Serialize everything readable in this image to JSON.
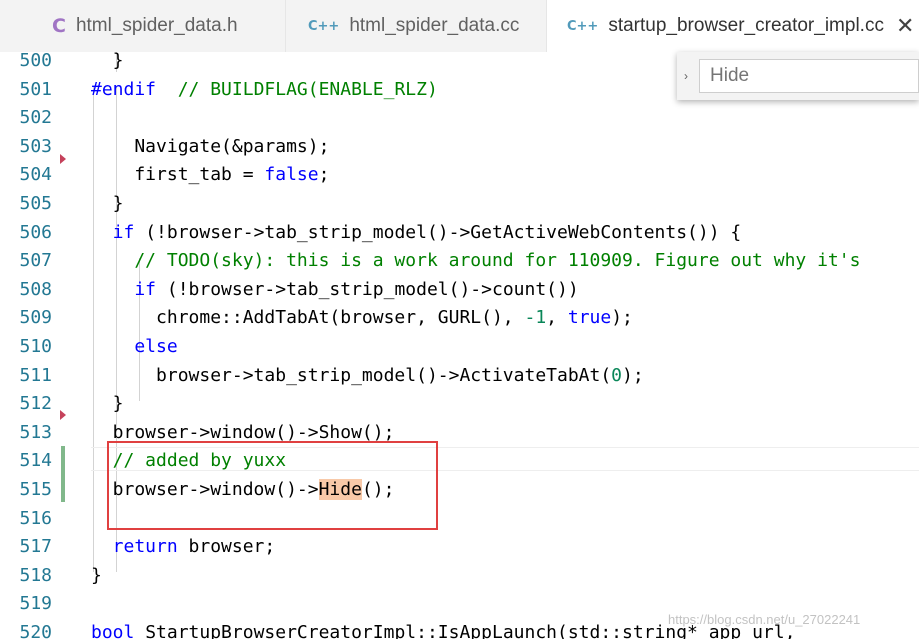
{
  "tabs": [
    {
      "icon": "C",
      "label": "html_spider_data.h"
    },
    {
      "icon": "C++",
      "label": "html_spider_data.cc"
    },
    {
      "icon": "C++",
      "label": "startup_browser_creator_impl.cc",
      "close": "✕"
    }
  ],
  "find": {
    "toggle": "›",
    "placeholder": "Hide"
  },
  "lines": [
    {
      "num": "500"
    },
    {
      "num": "501"
    },
    {
      "num": "502"
    },
    {
      "num": "503"
    },
    {
      "num": "504"
    },
    {
      "num": "505"
    },
    {
      "num": "506"
    },
    {
      "num": "507"
    },
    {
      "num": "508"
    },
    {
      "num": "509"
    },
    {
      "num": "510"
    },
    {
      "num": "511"
    },
    {
      "num": "512"
    },
    {
      "num": "513"
    },
    {
      "num": "514"
    },
    {
      "num": "515"
    },
    {
      "num": "516"
    },
    {
      "num": "517"
    },
    {
      "num": "518"
    },
    {
      "num": "519"
    },
    {
      "num": "520"
    }
  ],
  "code": {
    "l500": "  }",
    "l501a": "#endif",
    "l501b": "  // BUILDFLAG(ENABLE_RLZ)",
    "l503": "    Navigate(&params);",
    "l504a": "    first_tab = ",
    "l504b": "false",
    "l504c": ";",
    "l505": "  }",
    "l506a": "  if",
    "l506b": " (!browser->tab_strip_model()->GetActiveWebContents()) {",
    "l507": "    // TODO(sky): this is a work around for 110909. Figure out why it's",
    "l508a": "    if",
    "l508b": " (!browser->tab_strip_model()->count())",
    "l509a": "      chrome::AddTabAt(browser, GURL(), ",
    "l509b": "-1",
    "l509c": ", ",
    "l509d": "true",
    "l509e": ");",
    "l510": "    else",
    "l511a": "      browser->tab_strip_model()->ActivateTabAt(",
    "l511b": "0",
    "l511c": ");",
    "l512": "  }",
    "l513": "  browser->window()->Show();",
    "l514": "  // added by yuxx",
    "l515a": "  browser->window()->",
    "l515b": "Hide",
    "l515c": "();",
    "l517a": "  return",
    "l517b": " browser;",
    "l518": "}",
    "l520a": "bool",
    "l520b": " StartupBrowserCreatorImpl::IsAppLaunch(std::string* app_url,"
  },
  "watermark": "https://blog.csdn.net/u_27022241",
  "colors": {
    "keyword": "#0000ff",
    "comment": "#008000",
    "number": "#098658",
    "linenum": "#237893",
    "highlight": "#f8c9a8",
    "annotation_box": "#e04040"
  }
}
